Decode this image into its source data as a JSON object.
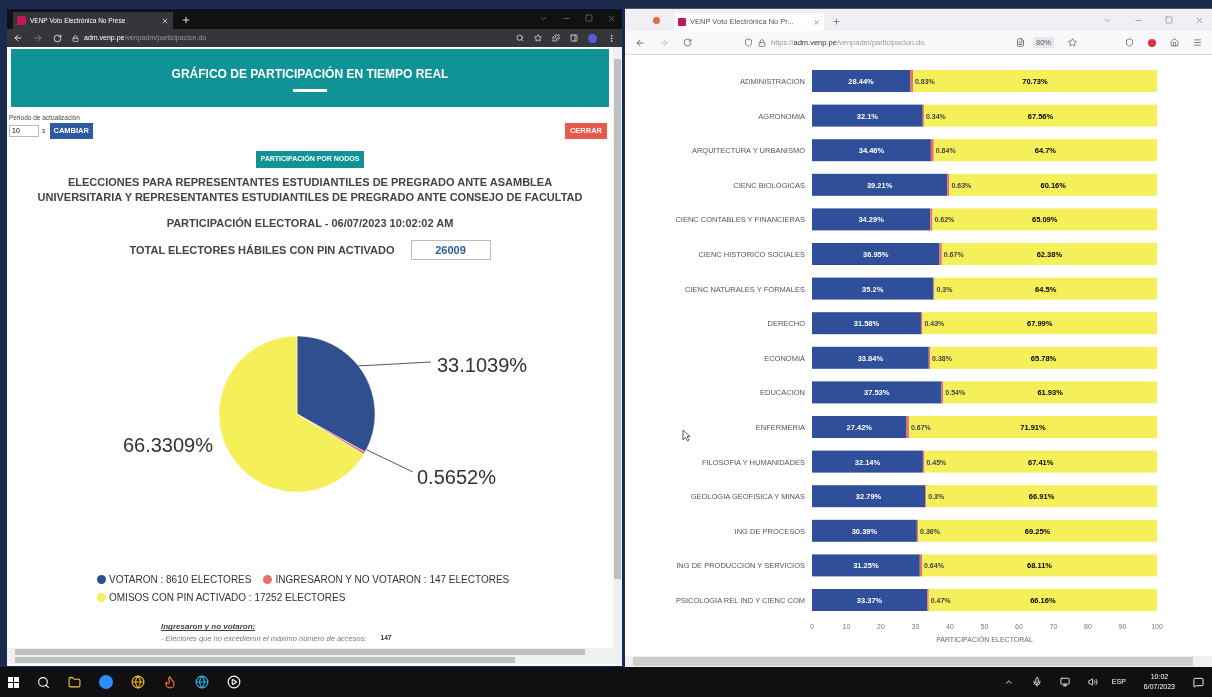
{
  "left_window": {
    "tab": {
      "title": "VENP Voto Electrónica No Prese",
      "selected": true
    },
    "address": {
      "host": "adm.venp.pe",
      "path": "/venpadm/participacion.do"
    },
    "header": {
      "title": "GRÁFICO DE PARTICIPACIÓN EN TIEMPO REAL"
    },
    "refresh": {
      "label": "Periodo de actualización",
      "value": "10",
      "unit": "s",
      "button": "CAMBIAR"
    },
    "close_button": "CERRAR",
    "nodes_button": "PARTICIPACIÓN POR NODOS",
    "title_lines": [
      "ELECCIONES PARA REPRESENTANTES ESTUDIANTILES DE PREGRADO ANTE ASAMBLEA",
      "UNIVERSITARIA Y REPRESENTANTES ESTUDIANTILES DE PREGRADO ANTE CONSEJO DE FACULTAD"
    ],
    "subtitle": "PARTICIPACIÓN ELECTORAL - 06/07/2023 10:02:02 AM",
    "total": {
      "label": "TOTAL ELECTORES HÁBILES CON PIN ACTIVADO",
      "value": "26009"
    },
    "chart_data": {
      "type": "pie",
      "series": [
        {
          "values": [
            33.1039,
            0.5652,
            66.3309
          ],
          "value_labels": [
            "33.1039%",
            "0.5652%",
            "66.3309%"
          ]
        }
      ],
      "colors": [
        "#2f4f8f",
        "#e8706a",
        "#f5ef5a"
      ]
    },
    "legend": [
      {
        "label": "VOTARON : 8610 ELECTORES",
        "color": "#2f4f8f"
      },
      {
        "label": "INGRESARON Y NO VOTARON : 147 ELECTORES",
        "color": "#e8706a"
      },
      {
        "label": "OMISOS CON PIN ACTIVADO : 17252 ELECTORES",
        "color": "#f5ef5a"
      }
    ],
    "note": {
      "heading": "Ingresaron y no votaron:",
      "line": "- Electores que no excedieron el máximo número de accesos:",
      "value": "147"
    }
  },
  "right_window": {
    "tab": {
      "title": "VENP Voto Electrónica No Pr...",
      "selected": true
    },
    "address": {
      "scheme": "https://",
      "host": "adm.venp.pe",
      "path": "/venpadm/participacion.do"
    },
    "zoom": "80%",
    "chart_data": {
      "type": "bar",
      "orientation": "horizontal",
      "stacked": true,
      "xlabel": "PARTICIPACIÓN ELECTORAL",
      "xlim": [
        0,
        100
      ],
      "xticks": [
        0,
        10,
        20,
        30,
        40,
        50,
        60,
        70,
        80,
        90,
        100
      ],
      "categories": [
        "ADMINISTRACION",
        "AGRONOMIA",
        "ARQUITECTURA Y URBANISMO",
        "CIENC BIOLOGICAS",
        "CIENC CONTABLES Y FINANCIERAS",
        "CIENC HISTORICO SOCIALES",
        "CIENC NATURALES Y FORMALES",
        "DERECHO",
        "ECONOMIA",
        "EDUCACION",
        "ENFERMERIA",
        "FILOSOFIA Y HUMANIDADES",
        "GEOLOGIA GEOFISICA Y MINAS",
        "ING DE PROCESOS",
        "ING DE PRODUCCION Y SERVICIOS",
        "PSICOLOGIA REL IND Y CIENC COM"
      ],
      "series": [
        {
          "color": "#2f4f9a",
          "values": [
            28.44,
            32.1,
            34.46,
            39.21,
            34.29,
            36.95,
            35.2,
            31.58,
            33.84,
            37.53,
            27.42,
            32.14,
            32.79,
            30.39,
            31.25,
            33.37
          ],
          "value_labels": [
            "28.44%",
            "32.1%",
            "34.46%",
            "39.21%",
            "34.29%",
            "36.95%",
            "35.2%",
            "31.58%",
            "33.84%",
            "37.53%",
            "27.42%",
            "32.14%",
            "32.79%",
            "30.39%",
            "31.25%",
            "33.37%"
          ]
        },
        {
          "color": "#e8706a",
          "values": [
            0.83,
            0.34,
            0.84,
            0.63,
            0.62,
            0.67,
            0.3,
            0.43,
            0.38,
            0.54,
            0.67,
            0.45,
            0.3,
            0.36,
            0.64,
            0.47
          ],
          "value_labels": [
            "0.83%",
            "0.34%",
            "0.84%",
            "0.63%",
            "0.62%",
            "0.67%",
            "0.3%",
            "0.43%",
            "0.38%",
            "0.54%",
            "0.67%",
            "0.45%",
            "0.3%",
            "0.36%",
            "0.64%",
            "0.47%"
          ]
        },
        {
          "color": "#f5f05a",
          "values": [
            70.73,
            67.56,
            64.7,
            60.16,
            65.09,
            62.38,
            64.5,
            67.99,
            65.78,
            61.93,
            71.91,
            67.41,
            66.91,
            69.25,
            68.11,
            66.16
          ],
          "value_labels": [
            "70.73%",
            "67.56%",
            "64.7%",
            "60.16%",
            "65.09%",
            "62.38%",
            "64.5%",
            "67.99%",
            "65.78%",
            "61.93%",
            "71.91%",
            "67.41%",
            "66.91%",
            "69.25%",
            "68.11%",
            "66.16%"
          ]
        }
      ]
    }
  },
  "taskbar": {
    "language": "ESP",
    "time": "10:02",
    "date": "6/07/2023"
  }
}
